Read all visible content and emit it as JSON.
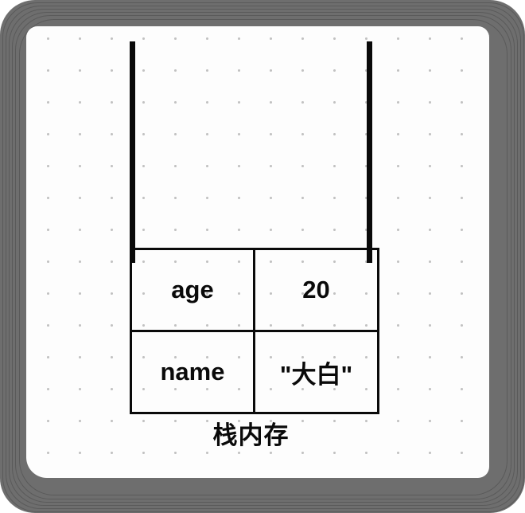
{
  "diagram": {
    "type": "stack-memory-diagram",
    "caption": "栈内存",
    "container": {
      "name": "stack-walls",
      "description": "open-top container formed by two vertical lines"
    },
    "rows": [
      {
        "key": "age",
        "value": "20"
      },
      {
        "key": "name",
        "value": "\"大白\""
      }
    ]
  },
  "colors": {
    "frame": "#6e6e6e",
    "canvas": "#fdfdfd",
    "grid_dot": "#c2c2c2",
    "ink": "#0a0a0a"
  }
}
